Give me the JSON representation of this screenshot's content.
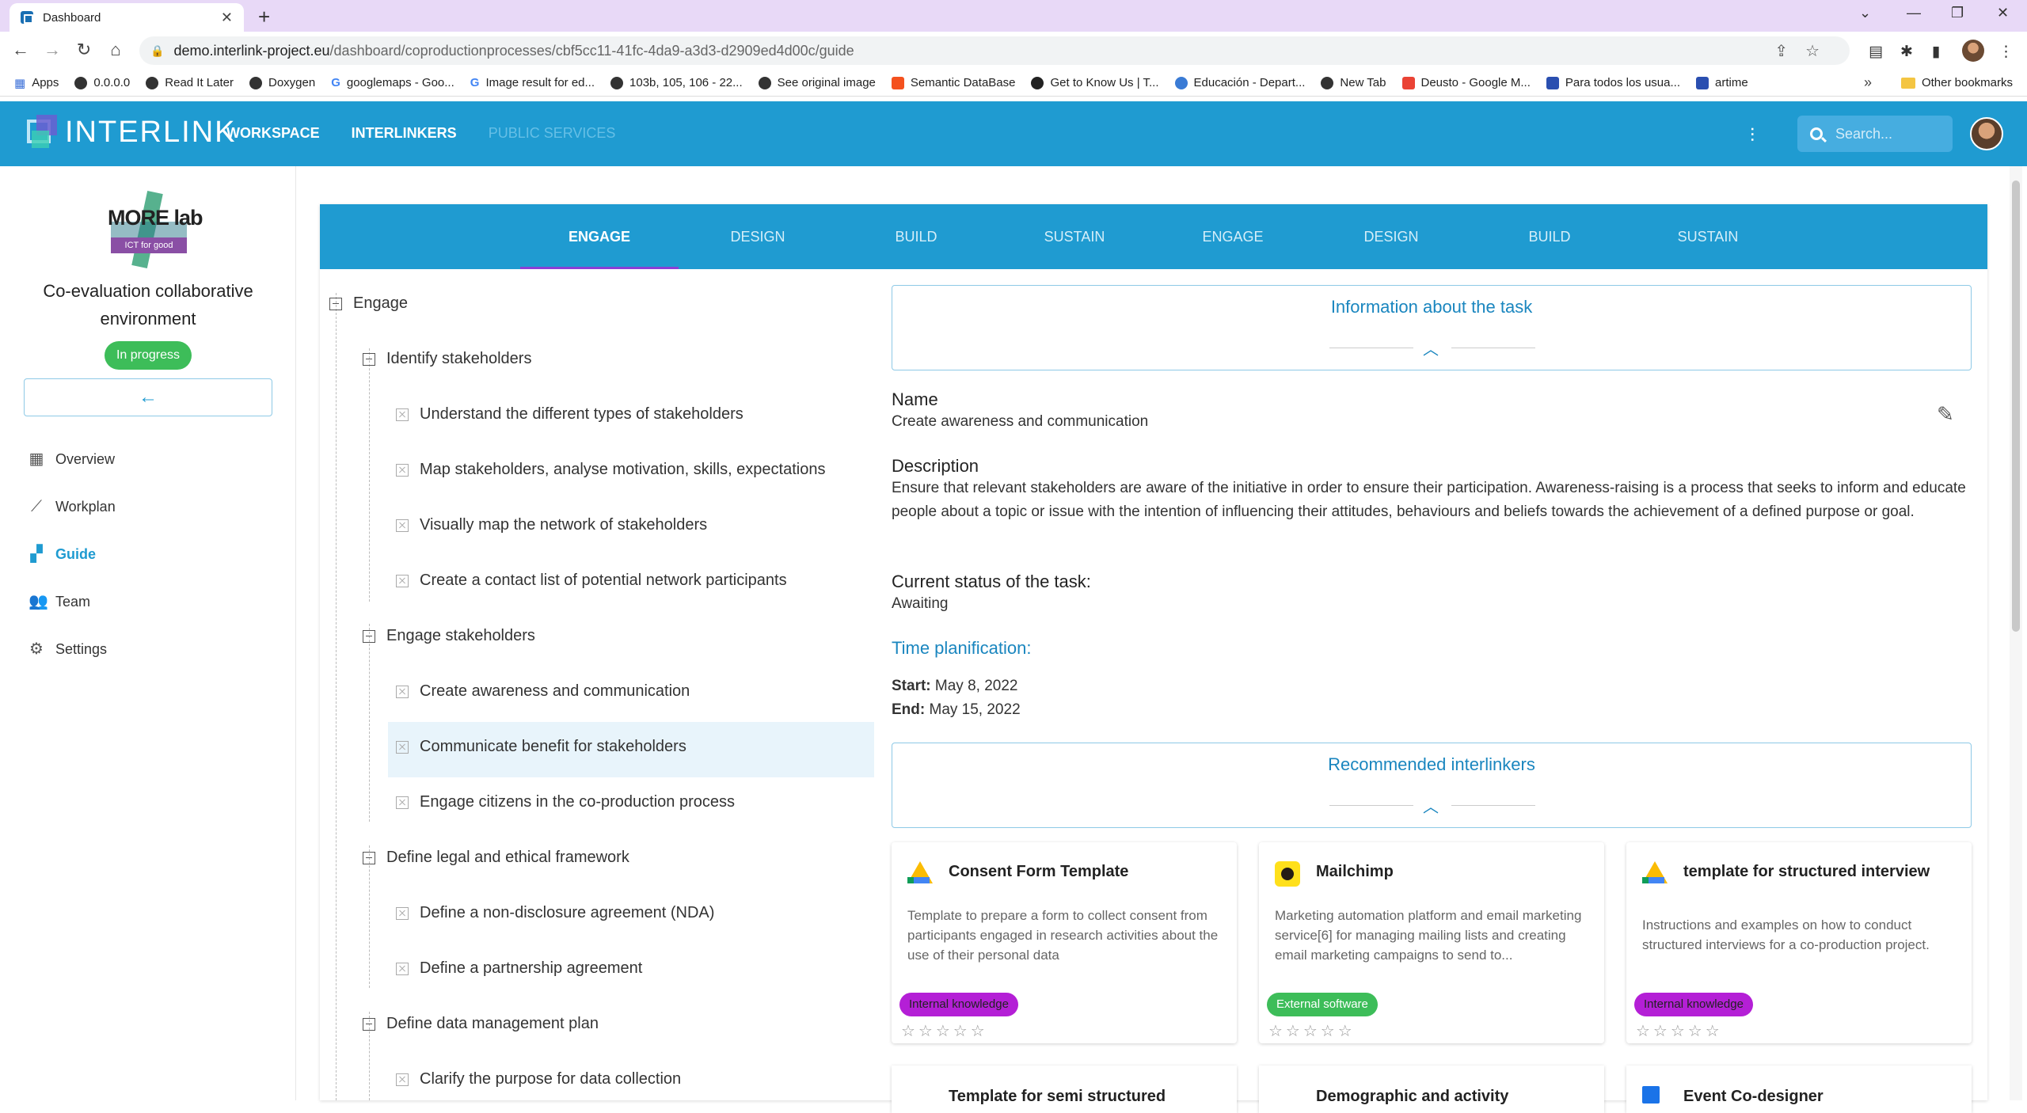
{
  "browser": {
    "tab_title": "Dashboard",
    "url_host": "demo.interlink-project.eu",
    "url_path": "/dashboard/coproductionprocesses/cbf5cc11-41fc-4da9-a3d3-d2909ed4d00c/guide",
    "bookmarks": [
      "Apps",
      "0.0.0.0",
      "Read It Later",
      "Doxygen",
      "googlemaps - Goo...",
      "Image result for ed...",
      "103b, 105, 106 - 22...",
      "See original image",
      "Semantic DataBase",
      "Get to Know Us | T...",
      "Educación - Depart...",
      "New Tab",
      "Deusto - Google M...",
      "Para todos los usua...",
      "artime"
    ],
    "other_bookmarks": "Other bookmarks"
  },
  "appbar": {
    "logo_text": "INTERLINK",
    "nav": [
      "WORKSPACE",
      "INTERLINKERS",
      "PUBLIC SERVICES"
    ],
    "search_placeholder": "Search..."
  },
  "sidebar": {
    "project_logo_text": "MORE lab",
    "project_logo_sub": "ICT for good",
    "project_title": "Co-evaluation collaborative environment",
    "status": "In progress",
    "items": [
      {
        "label": "Overview",
        "icon": "dashboard-icon"
      },
      {
        "label": "Workplan",
        "icon": "timeline-icon"
      },
      {
        "label": "Guide",
        "icon": "guide-icon"
      },
      {
        "label": "Team",
        "icon": "team-icon"
      },
      {
        "label": "Settings",
        "icon": "gear-icon"
      }
    ]
  },
  "phases": [
    "ENGAGE",
    "DESIGN",
    "BUILD",
    "SUSTAIN",
    "ENGAGE",
    "DESIGN",
    "BUILD",
    "SUSTAIN"
  ],
  "tree": {
    "root": "Engage",
    "objectives": [
      {
        "label": "Identify stakeholders",
        "tasks": [
          "Understand the different types of stakeholders",
          "Map stakeholders, analyse motivation, skills, expectations",
          "Visually map the network of stakeholders",
          "Create a contact list of potential network participants"
        ]
      },
      {
        "label": "Engage stakeholders",
        "tasks": [
          "Create awareness and communication",
          "Communicate benefit for stakeholders",
          "Engage citizens in the co-production process"
        ]
      },
      {
        "label": "Define legal and ethical framework",
        "tasks": [
          "Define a non-disclosure agreement (NDA)",
          "Define a partnership agreement"
        ]
      },
      {
        "label": "Define data management plan",
        "tasks": [
          "Clarify the purpose for data collection"
        ]
      }
    ]
  },
  "task": {
    "info_header": "Information about the task",
    "name_label": "Name",
    "name": "Create awareness and communication",
    "description_label": "Description",
    "description": "Ensure that relevant stakeholders are aware of the initiative in order to ensure their participation. Awareness-raising is a process that seeks to inform and educate people about a topic or issue with the intention of influencing their attitudes, behaviours and beliefs towards the achievement of a defined purpose or goal.",
    "status_label": "Current status of the task:",
    "status": "Awaiting",
    "time_label": "Time planification:",
    "start_label": "Start:",
    "start": "May 8, 2022",
    "end_label": "End:",
    "end": "May 15, 2022",
    "recommended_header": "Recommended interlinkers"
  },
  "interlinkers": [
    {
      "title": "Consent Form Template",
      "description": "Template to prepare a form to collect consent from participants engaged in research activities about the use of their personal data",
      "badge": "Internal knowledge",
      "badge_color": "#b41fd6",
      "icon": "google-drive-icon"
    },
    {
      "title": "Mailchimp",
      "description": "Marketing automation platform and email marketing service[6] for managing mailing lists and creating email marketing campaigns to send to...",
      "badge": "External software",
      "badge_color": "#3dbd59",
      "icon": "mailchimp-icon"
    },
    {
      "title": "template for structured interview",
      "description": "Instructions and examples on how to conduct structured interviews for a co-production project.",
      "badge": "Internal knowledge",
      "badge_color": "#b41fd6",
      "icon": "google-drive-icon"
    }
  ],
  "interlinkers_more": [
    "Template for semi structured",
    "Demographic and activity",
    "Event Co-designer"
  ],
  "stars": "☆☆☆☆☆"
}
